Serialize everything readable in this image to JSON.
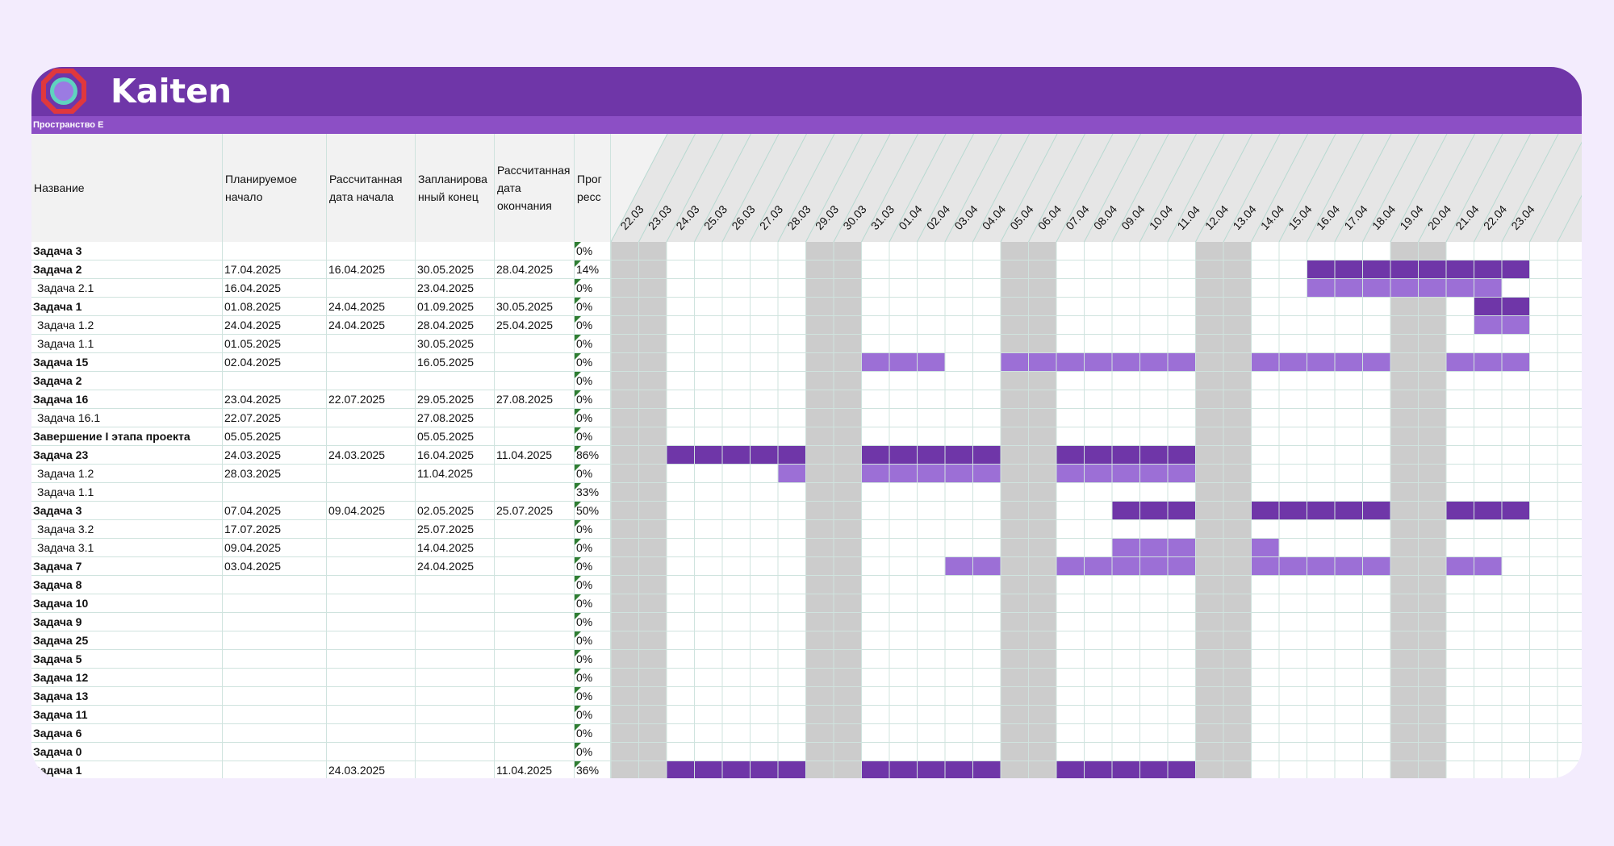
{
  "app": {
    "title": "Kaiten",
    "space": "Пространство E"
  },
  "colors": {
    "header": "#6f36a8",
    "subbar": "#8c4fc5",
    "bar_dark": "#6f36a8",
    "bar_light": "#9c6fd6",
    "weekend": "#cccccc",
    "progress_marker": "#2f7d32"
  },
  "columns": {
    "name": "Название",
    "planned_start": "Планируемое начало",
    "calc_start": "Рассчитанная дата начала",
    "planned_end": "Запланирова нный конец",
    "calc_end": "Рассчитанная дата окончания",
    "progress": "Прог ресс"
  },
  "dates": [
    "22.03",
    "23.03",
    "24.03",
    "25.03",
    "26.03",
    "27.03",
    "28.03",
    "29.03",
    "30.03",
    "31.03",
    "01.04",
    "02.04",
    "03.04",
    "04.04",
    "05.04",
    "06.04",
    "07.04",
    "08.04",
    "09.04",
    "10.04",
    "11.04",
    "12.04",
    "13.04",
    "14.04",
    "15.04",
    "16.04",
    "17.04",
    "18.04",
    "19.04",
    "20.04",
    "21.04",
    "22.04",
    "23.04"
  ],
  "weekend_dates": [
    "22.03",
    "23.03",
    "29.03",
    "30.03",
    "05.04",
    "06.04",
    "12.04",
    "13.04",
    "19.04",
    "20.04"
  ],
  "rows": [
    {
      "name": "Задача 3",
      "level": "top",
      "planned_start": "",
      "calc_start": "",
      "planned_end": "",
      "calc_end": "",
      "progress": "0%",
      "bar": null
    },
    {
      "name": "Задача 2",
      "level": "top",
      "planned_start": "17.04.2025",
      "calc_start": "16.04.2025",
      "planned_end": "30.05.2025",
      "calc_end": "28.04.2025",
      "progress": "14%",
      "bar": {
        "tone": "dark",
        "days": [
          "16.04",
          "17.04",
          "18.04",
          "19.04",
          "20.04",
          "21.04",
          "22.04",
          "23.04"
        ]
      }
    },
    {
      "name": "Задача 2.1",
      "level": "sub",
      "planned_start": "16.04.2025",
      "calc_start": "",
      "planned_end": "23.04.2025",
      "calc_end": "",
      "progress": "0%",
      "bar": {
        "tone": "light",
        "days": [
          "16.04",
          "17.04",
          "18.04",
          "19.04",
          "20.04",
          "21.04",
          "22.04"
        ]
      }
    },
    {
      "name": "Задача 1",
      "level": "top",
      "planned_start": "01.08.2025",
      "calc_start": "24.04.2025",
      "planned_end": "01.09.2025",
      "calc_end": "30.05.2025",
      "progress": "0%",
      "bar": {
        "tone": "dark",
        "days": [
          "22.04",
          "23.04"
        ]
      }
    },
    {
      "name": "Задача 1.2",
      "level": "sub",
      "planned_start": "24.04.2025",
      "calc_start": "24.04.2025",
      "planned_end": "28.04.2025",
      "calc_end": "25.04.2025",
      "progress": "0%",
      "bar": {
        "tone": "light",
        "days": [
          "22.04",
          "23.04"
        ]
      }
    },
    {
      "name": "Задача 1.1",
      "level": "sub",
      "planned_start": "01.05.2025",
      "calc_start": "",
      "planned_end": "30.05.2025",
      "calc_end": "",
      "progress": "0%",
      "bar": null
    },
    {
      "name": "Задача 15",
      "level": "top",
      "planned_start": "02.04.2025",
      "calc_start": "",
      "planned_end": "16.05.2025",
      "calc_end": "",
      "progress": "0%",
      "bar": {
        "tone": "light",
        "days": [
          "31.03",
          "01.04",
          "02.04",
          "05.04",
          "06.04",
          "07.04",
          "08.04",
          "09.04",
          "10.04",
          "11.04",
          "14.04",
          "15.04",
          "16.04",
          "17.04",
          "18.04",
          "21.04",
          "22.04",
          "23.04"
        ]
      }
    },
    {
      "name": "Задача 2",
      "level": "top",
      "planned_start": "",
      "calc_start": "",
      "planned_end": "",
      "calc_end": "",
      "progress": "0%",
      "bar": null
    },
    {
      "name": "Задача 16",
      "level": "top",
      "planned_start": "23.04.2025",
      "calc_start": "22.07.2025",
      "planned_end": "29.05.2025",
      "calc_end": "27.08.2025",
      "progress": "0%",
      "bar": null
    },
    {
      "name": "Задача 16.1",
      "level": "sub",
      "planned_start": "22.07.2025",
      "calc_start": "",
      "planned_end": "27.08.2025",
      "calc_end": "",
      "progress": "0%",
      "bar": null
    },
    {
      "name": "Завершение I этапа проекта",
      "level": "top",
      "planned_start": "05.05.2025",
      "calc_start": "",
      "planned_end": "05.05.2025",
      "calc_end": "",
      "progress": "0%",
      "bar": null
    },
    {
      "name": "Задача 23",
      "level": "top",
      "planned_start": "24.03.2025",
      "calc_start": "24.03.2025",
      "planned_end": "16.04.2025",
      "calc_end": "11.04.2025",
      "progress": "86%",
      "bar": {
        "tone": "dark",
        "days": [
          "24.03",
          "25.03",
          "26.03",
          "27.03",
          "28.03",
          "31.03",
          "01.04",
          "02.04",
          "03.04",
          "04.04",
          "07.04",
          "08.04",
          "09.04",
          "10.04",
          "11.04"
        ]
      }
    },
    {
      "name": "Задача 1.2",
      "level": "sub",
      "planned_start": "28.03.2025",
      "calc_start": "",
      "planned_end": "11.04.2025",
      "calc_end": "",
      "progress": "0%",
      "bar": {
        "tone": "light",
        "days": [
          "28.03",
          "31.03",
          "01.04",
          "02.04",
          "03.04",
          "04.04",
          "07.04",
          "08.04",
          "09.04",
          "10.04",
          "11.04"
        ]
      }
    },
    {
      "name": "Задача 1.1",
      "level": "sub",
      "planned_start": "",
      "calc_start": "",
      "planned_end": "",
      "calc_end": "",
      "progress": "33%",
      "bar": null
    },
    {
      "name": "Задача 3",
      "level": "top",
      "planned_start": "07.04.2025",
      "calc_start": "09.04.2025",
      "planned_end": "02.05.2025",
      "calc_end": "25.07.2025",
      "progress": "50%",
      "bar": {
        "tone": "dark",
        "days": [
          "09.04",
          "10.04",
          "11.04",
          "14.04",
          "15.04",
          "16.04",
          "17.04",
          "18.04",
          "21.04",
          "22.04",
          "23.04"
        ]
      }
    },
    {
      "name": "Задача 3.2",
      "level": "sub",
      "planned_start": "17.07.2025",
      "calc_start": "",
      "planned_end": "25.07.2025",
      "calc_end": "",
      "progress": "0%",
      "bar": null
    },
    {
      "name": "Задача 3.1",
      "level": "sub",
      "planned_start": "09.04.2025",
      "calc_start": "",
      "planned_end": "14.04.2025",
      "calc_end": "",
      "progress": "0%",
      "bar": {
        "tone": "light",
        "days": [
          "09.04",
          "10.04",
          "11.04",
          "14.04"
        ]
      }
    },
    {
      "name": "Задача 7",
      "level": "top",
      "planned_start": "03.04.2025",
      "calc_start": "",
      "planned_end": "24.04.2025",
      "calc_end": "",
      "progress": "0%",
      "bar": {
        "tone": "light",
        "days": [
          "03.04",
          "04.04",
          "07.04",
          "08.04",
          "09.04",
          "10.04",
          "11.04",
          "14.04",
          "15.04",
          "16.04",
          "17.04",
          "18.04",
          "21.04",
          "22.04"
        ]
      }
    },
    {
      "name": "Задача 8",
      "level": "top",
      "planned_start": "",
      "calc_start": "",
      "planned_end": "",
      "calc_end": "",
      "progress": "0%",
      "bar": null
    },
    {
      "name": "Задача 10",
      "level": "top",
      "planned_start": "",
      "calc_start": "",
      "planned_end": "",
      "calc_end": "",
      "progress": "0%",
      "bar": null
    },
    {
      "name": "Задача 9",
      "level": "top",
      "planned_start": "",
      "calc_start": "",
      "planned_end": "",
      "calc_end": "",
      "progress": "0%",
      "bar": null
    },
    {
      "name": "Задача 25",
      "level": "top",
      "planned_start": "",
      "calc_start": "",
      "planned_end": "",
      "calc_end": "",
      "progress": "0%",
      "bar": null
    },
    {
      "name": "Задача 5",
      "level": "top",
      "planned_start": "",
      "calc_start": "",
      "planned_end": "",
      "calc_end": "",
      "progress": "0%",
      "bar": null
    },
    {
      "name": "Задача 12",
      "level": "top",
      "planned_start": "",
      "calc_start": "",
      "planned_end": "",
      "calc_end": "",
      "progress": "0%",
      "bar": null
    },
    {
      "name": "Задача 13",
      "level": "top",
      "planned_start": "",
      "calc_start": "",
      "planned_end": "",
      "calc_end": "",
      "progress": "0%",
      "bar": null
    },
    {
      "name": "Задача 11",
      "level": "top",
      "planned_start": "",
      "calc_start": "",
      "planned_end": "",
      "calc_end": "",
      "progress": "0%",
      "bar": null
    },
    {
      "name": "Задача 6",
      "level": "top",
      "planned_start": "",
      "calc_start": "",
      "planned_end": "",
      "calc_end": "",
      "progress": "0%",
      "bar": null
    },
    {
      "name": "Задача 0",
      "level": "top",
      "planned_start": "",
      "calc_start": "",
      "planned_end": "",
      "calc_end": "",
      "progress": "0%",
      "bar": null
    },
    {
      "name": "Задача 1",
      "level": "top",
      "planned_start": "",
      "calc_start": "24.03.2025",
      "planned_end": "",
      "calc_end": "11.04.2025",
      "progress": "36%",
      "bar": {
        "tone": "dark",
        "days": [
          "24.03",
          "25.03",
          "26.03",
          "27.03",
          "28.03",
          "31.03",
          "01.04",
          "02.04",
          "03.04",
          "04.04",
          "07.04",
          "08.04",
          "09.04",
          "10.04",
          "11.04"
        ]
      }
    }
  ]
}
